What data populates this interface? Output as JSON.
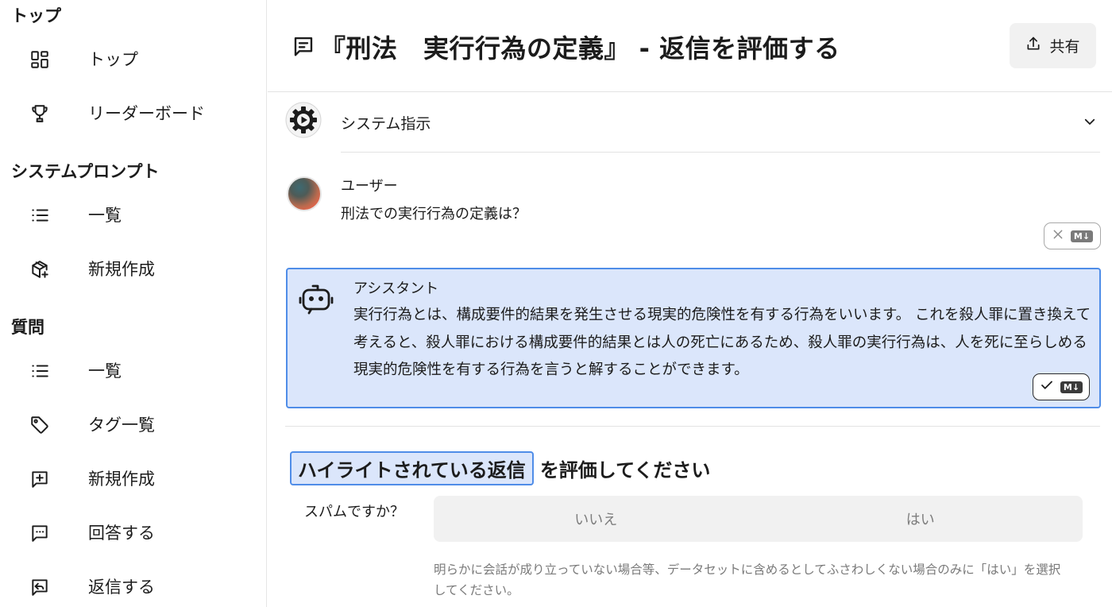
{
  "sidebar": {
    "sections": [
      {
        "title": "トップ",
        "items": [
          {
            "label": "トップ",
            "icon": "grid-icon"
          },
          {
            "label": "リーダーボード",
            "icon": "trophy-icon"
          }
        ]
      },
      {
        "title": "システムプロンプト",
        "items": [
          {
            "label": "一覧",
            "icon": "list-icon"
          },
          {
            "label": "新規作成",
            "icon": "box-plus-icon"
          }
        ]
      },
      {
        "title": "質問",
        "items": [
          {
            "label": "一覧",
            "icon": "list-icon"
          },
          {
            "label": "タグ一覧",
            "icon": "tag-icon"
          },
          {
            "label": "新規作成",
            "icon": "message-plus-icon"
          },
          {
            "label": "回答する",
            "icon": "message-dots-icon"
          },
          {
            "label": "返信する",
            "icon": "message-reply-icon"
          }
        ]
      }
    ]
  },
  "header": {
    "title": "『刑法　実行行為の定義』 - 返信を評価する",
    "share_label": "共有"
  },
  "conversation": {
    "system": {
      "label": "システム指示"
    },
    "user": {
      "name": "ユーザー",
      "message": "刑法での実行行為の定義は？"
    },
    "assistant": {
      "name": "アシスタント",
      "message": "実行行為とは、構成要件的結果を発生させる現実的危険性を有する行為をいいます。 これを殺人罪に置き換えて考えると、殺人罪における構成要件的結果とは人の死亡にあるため、殺人罪の実行行為は、人を死に至らしめる現実的危険性を有する行為を言うと解することができます。"
    },
    "markdown_badge": "M↓"
  },
  "evaluation": {
    "heading_highlight": "ハイライトされている返信",
    "heading_rest": "を評価してください",
    "spam_question": "スパムですか？",
    "spam_options": [
      "いいえ",
      "はい"
    ],
    "spam_help": "明らかに会話が成り立っていない場合等、データセットに含めるとしてふさわしくない場合のみに「はい」を選択してください。"
  },
  "colors": {
    "highlight_bg": "#dbe6fb",
    "highlight_border": "#4f8de8",
    "button_bg": "#f1f1f1"
  }
}
